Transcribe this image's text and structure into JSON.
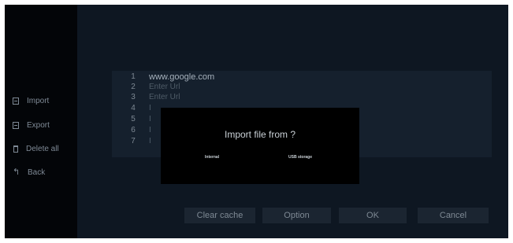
{
  "sidebar": {
    "items": [
      {
        "label": "Import",
        "icon": "import-icon"
      },
      {
        "label": "Export",
        "icon": "export-icon"
      },
      {
        "label": "Delete all",
        "icon": "trash-icon"
      },
      {
        "label": "Back",
        "icon": "back-arrow-icon"
      }
    ]
  },
  "url_list": {
    "rows": [
      {
        "num": "1",
        "text": "www.google.com"
      },
      {
        "num": "2",
        "text": "Enter Url"
      },
      {
        "num": "3",
        "text": "Enter Url"
      },
      {
        "num": "4",
        "text": "I"
      },
      {
        "num": "5",
        "text": "I"
      },
      {
        "num": "6",
        "text": "I"
      },
      {
        "num": "7",
        "text": "I"
      }
    ]
  },
  "dialog": {
    "title": "Import file from ?",
    "options": [
      "Internal",
      "USB storage"
    ]
  },
  "buttons": {
    "clear_cache": "Clear cache",
    "option": "Option",
    "ok": "OK",
    "cancel": "Cancel"
  },
  "colors": {
    "screen_bg": "#0e1722",
    "sidebar_bg": "#030508",
    "panel_bg": "#15202d",
    "dialog_bg": "#000000",
    "button_bg": "#1b2531"
  }
}
